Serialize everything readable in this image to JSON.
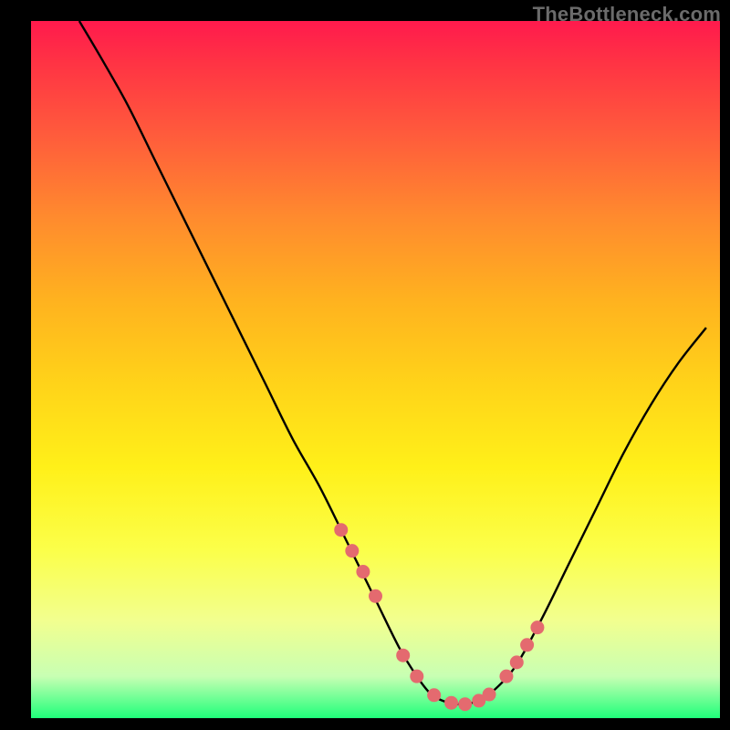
{
  "watermark": "TheBottleneck.com",
  "chart_data": {
    "type": "line",
    "title": "",
    "xlabel": "",
    "ylabel": "",
    "xlim": [
      0,
      100
    ],
    "ylim": [
      0,
      100
    ],
    "curve": {
      "name": "bottleneck-curve",
      "x": [
        7,
        10,
        14,
        18,
        22,
        26,
        30,
        34,
        38,
        42,
        46,
        50,
        53.5,
        56,
        58,
        60,
        62,
        64,
        66,
        70,
        74,
        78,
        82,
        86,
        90,
        94,
        98
      ],
      "y": [
        100,
        95,
        88,
        80,
        72,
        64,
        56,
        48,
        40,
        33,
        25,
        17,
        10,
        6,
        3.5,
        2.4,
        2,
        2.2,
        3,
        7,
        14,
        22,
        30,
        38,
        45,
        51,
        56
      ]
    },
    "highlight_dots": {
      "name": "curve-markers",
      "x": [
        45.0,
        46.6,
        48.2,
        50.0,
        54.0,
        56.0,
        58.5,
        61.0,
        63.0,
        65.0,
        66.5,
        69.0,
        70.5,
        72.0,
        73.5
      ],
      "y": [
        27.0,
        24.0,
        21.0,
        17.5,
        9.0,
        6.0,
        3.3,
        2.2,
        2.0,
        2.5,
        3.4,
        6.0,
        8.0,
        10.5,
        13.0
      ]
    },
    "background_gradient": {
      "top": "#ff1a4d",
      "mid1": "#ffd319",
      "mid2": "#fbff4a",
      "near_bottom": "#c8ffb3",
      "bottom": "#1fff7a"
    }
  }
}
